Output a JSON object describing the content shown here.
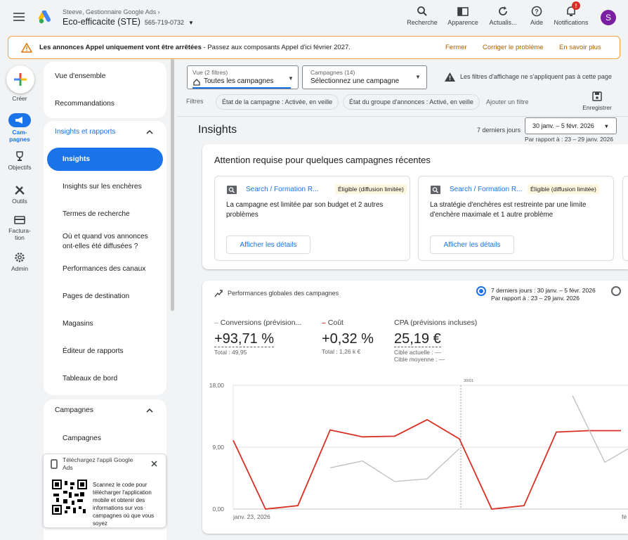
{
  "header": {
    "account_path": "Steeve, Gestionnaire Google Ads",
    "account_name": "Eco-efficacite (STE)",
    "account_id": "565-719-0732",
    "actions": [
      {
        "label": "Recherche",
        "icon": "search-icon"
      },
      {
        "label": "Apparence",
        "icon": "appearance-icon"
      },
      {
        "label": "Actualis...",
        "icon": "refresh-icon"
      },
      {
        "label": "Aide",
        "icon": "help-icon"
      },
      {
        "label": "Notifications",
        "icon": "bell-icon",
        "badge": "!"
      }
    ],
    "avatar_letter": "S"
  },
  "alert": {
    "title": "Les annonces Appel uniquement vont être arrêtées",
    "text": " - Passez aux composants Appel d'ici février 2027.",
    "actions": [
      "Fermer",
      "Corriger le problème",
      "En savoir plus"
    ]
  },
  "rail": {
    "create": "Créer",
    "items": [
      {
        "label": "Cam-\npagnes",
        "icon": "megaphone-icon",
        "active": true
      },
      {
        "label": "Objectifs",
        "icon": "trophy-icon"
      },
      {
        "label": "Outils",
        "icon": "tools-icon"
      },
      {
        "label": "Factura-\ntion",
        "icon": "billing-icon"
      },
      {
        "label": "Admin",
        "icon": "gear-icon"
      }
    ]
  },
  "sidebar": {
    "overview": "Vue d'ensemble",
    "recommendations": "Recommandations",
    "insights_section": "Insights et rapports",
    "insights_items": [
      "Insights",
      "Insights sur les enchères",
      "Termes de recherche",
      "Où et quand vos annonces ont-elles été diffusées ?",
      "Performances des canaux",
      "Pages de destination",
      "Magasins",
      "Éditeur de rapports",
      "Tableaux de bord"
    ],
    "campaigns_section": "Campagnes",
    "campaigns_items": [
      "Campagnes"
    ],
    "app_promo": {
      "title": "Téléchargez l'appli Google Ads",
      "text": "Scannez le code pour télécharger l'application mobile et obtenir des informations sur vos campagnes où que vous soyez"
    }
  },
  "filters": {
    "view_label": "Vue (2 filtres)",
    "view_value": "Toutes les campagnes",
    "campaigns_label": "Campagnes (14)",
    "campaigns_value": "Sélectionnez une campagne",
    "notice": "Les filtres d'affichage ne s'appliquent pas à cette page",
    "filters_label": "Filtres",
    "chips": [
      "État de la campagne : Activée, en veille",
      "État du groupe d'annonces : Activé, en veille"
    ],
    "add_filter": "Ajouter un filtre",
    "save": "Enregistrer"
  },
  "page": {
    "title": "Insights",
    "range_label": "7 derniers jours",
    "range_value": "30 janv. – 5 févr. 2026",
    "compare": "Par rapport à : 23 – 29 janv. 2026"
  },
  "attention": {
    "title": "Attention requise pour quelques campagnes récentes",
    "cards": [
      {
        "campaign": "Search / Formation R...",
        "status": "Éligible (diffusion limitée)",
        "text": "La campagne est limitée par son budget et 2 autres problèmes",
        "button": "Afficher les détails"
      },
      {
        "campaign": "Search / Formation R...",
        "status": "Éligible (diffusion limitée)",
        "text": "La stratégie d'enchères est restreinte par une limite d'enchère maximale et 1 autre problème",
        "button": "Afficher les détails"
      }
    ]
  },
  "performance": {
    "title": "Performances globales des campagnes",
    "period_line1": "7 derniers jours : 30 janv. – 5 févr. 2026",
    "period_line2": "Par rapport à : 23 – 29 janv. 2026",
    "metrics": [
      {
        "label": "Conversions (prévision...",
        "value": "+93,71 %",
        "sub1": "Total : 49,95",
        "sub2": "",
        "color": "#9aa0a6"
      },
      {
        "label": "Coût",
        "value": "+0,32 %",
        "sub1": "Total : 1,26 k €",
        "sub2": "",
        "color": "#d93025"
      },
      {
        "label": "CPA (prévisions incluses)",
        "value": "25,19 €",
        "sub1": "Cible actuelle : —",
        "sub2": "Cible moyenne : —",
        "color": ""
      }
    ]
  },
  "chart_data": {
    "type": "line",
    "y_ticks": [
      "18,00",
      "9,00",
      "0,00"
    ],
    "ylim": [
      0,
      18
    ],
    "x_labels": [
      "janv. 23, 2026",
      "fé"
    ],
    "marker_label": "30/01",
    "series": [
      {
        "color": "#d93025",
        "points": [
          [
            0,
            10
          ],
          [
            1,
            0
          ],
          [
            2,
            0.5
          ],
          [
            3,
            11.5
          ],
          [
            4,
            10.5
          ],
          [
            5,
            10.6
          ],
          [
            6,
            13
          ],
          [
            7,
            10.2
          ],
          [
            8,
            0
          ],
          [
            9,
            0.5
          ],
          [
            10,
            11.2
          ],
          [
            11,
            11.4
          ],
          [
            12,
            11.4
          ]
        ]
      },
      {
        "color": "#bdbdbd",
        "points": [
          [
            3,
            6
          ],
          [
            4,
            7
          ],
          [
            5,
            4
          ],
          [
            6,
            4.4
          ],
          [
            7,
            8.8
          ]
        ]
      },
      {
        "color": "#bdbdbd",
        "points": [
          [
            10.5,
            16.5
          ],
          [
            11.5,
            6.8
          ],
          [
            12.6,
            9.8
          ]
        ]
      }
    ]
  },
  "colors": {
    "accent": "#1a73e8",
    "cost": "#d93025",
    "warning": "#f0a43b"
  }
}
